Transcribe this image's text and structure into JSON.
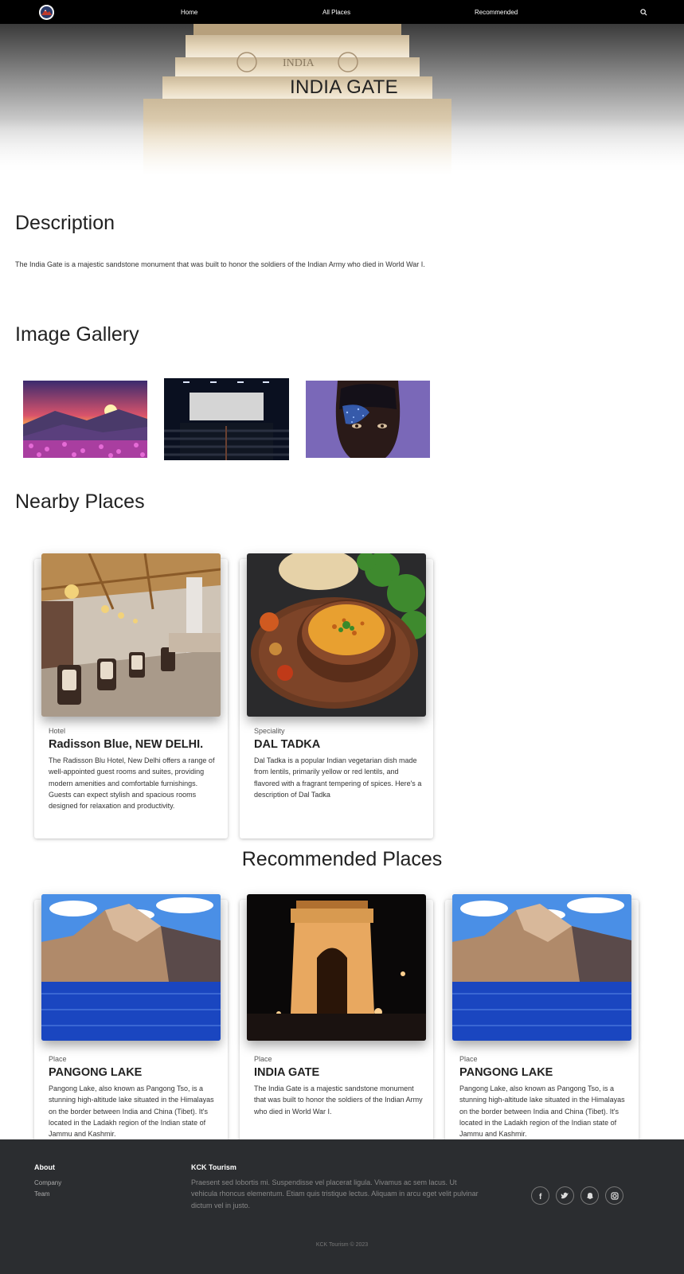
{
  "nav": {
    "links": [
      "Home",
      "All Places",
      "Recommended"
    ]
  },
  "hero": {
    "title": "INDIA GATE",
    "inscription": "INDIA"
  },
  "description": {
    "heading": "Description",
    "text": "The India Gate is a majestic sandstone monument that was built to honor the soldiers of the Indian Army who died in World War I."
  },
  "gallery": {
    "heading": "Image Gallery",
    "images": [
      "mountain-sunset-flowers",
      "cinema-hall",
      "face-glitter-portrait"
    ]
  },
  "nearby": {
    "heading": "Nearby Places",
    "cards": [
      {
        "category": "Hotel",
        "title": "Radisson Blue, NEW DELHI.",
        "text": "The Radisson Blu Hotel, New Delhi offers a range of well-appointed guest rooms and suites, providing modern amenities and comfortable furnishings. Guests can expect stylish and spacious rooms designed for relaxation and productivity."
      },
      {
        "category": "Speciality",
        "title": "DAL TADKA",
        "text": "Dal Tadka is a popular Indian vegetarian dish made from lentils, primarily yellow or red lentils, and flavored with a fragrant tempering of spices. Here's a description of Dal Tadka"
      }
    ]
  },
  "recommended": {
    "heading": "Recommended Places",
    "cards": [
      {
        "category": "Place",
        "title": "PANGONG LAKE",
        "text": "Pangong Lake, also known as Pangong Tso, is a stunning high-altitude lake situated in the Himalayas on the border between India and China (Tibet). It's located in the Ladakh region of the Indian state of Jammu and Kashmir."
      },
      {
        "category": "Place",
        "title": "INDIA GATE",
        "text": "The India Gate is a majestic sandstone monument that was built to honor the soldiers of the Indian Army who died in World War I."
      },
      {
        "category": "Place",
        "title": "PANGONG LAKE",
        "text": "Pangong Lake, also known as Pangong Tso, is a stunning high-altitude lake situated in the Himalayas on the border between India and China (Tibet). It's located in the Ladakh region of the Indian state of Jammu and Kashmir."
      }
    ]
  },
  "footer": {
    "about_heading": "About",
    "about_links": [
      "Company",
      "Team"
    ],
    "brand_heading": "KCK Tourism",
    "brand_text": "Praesent sed lobortis mi. Suspendisse vel placerat ligula. Vivamus ac sem lacus. Ut vehicula rhoncus elementum. Etiam quis tristique lectus. Aliquam in arcu eget velit pulvinar dictum vel in justo.",
    "social": [
      "facebook-icon",
      "twitter-icon",
      "snapchat-icon",
      "instagram-icon"
    ],
    "copyright": "KCK Tourism © 2023"
  },
  "colors": {
    "nav_bg": "#000000",
    "footer_bg": "#2b2d30"
  }
}
